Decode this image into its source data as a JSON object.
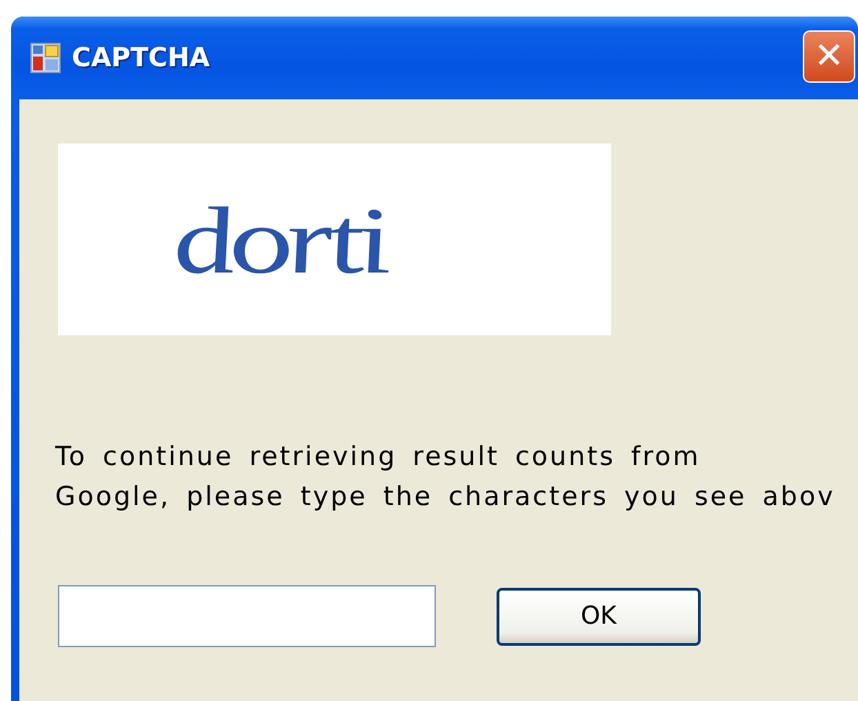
{
  "window": {
    "title": "CAPTCHA",
    "close_glyph": "✕"
  },
  "captcha": {
    "text": "dorti"
  },
  "message": [
    "To continue retrieving result counts from",
    "Google, please type the characters you see abov"
  ],
  "buttons": [
    {
      "label": "OK",
      "default": true
    }
  ]
}
